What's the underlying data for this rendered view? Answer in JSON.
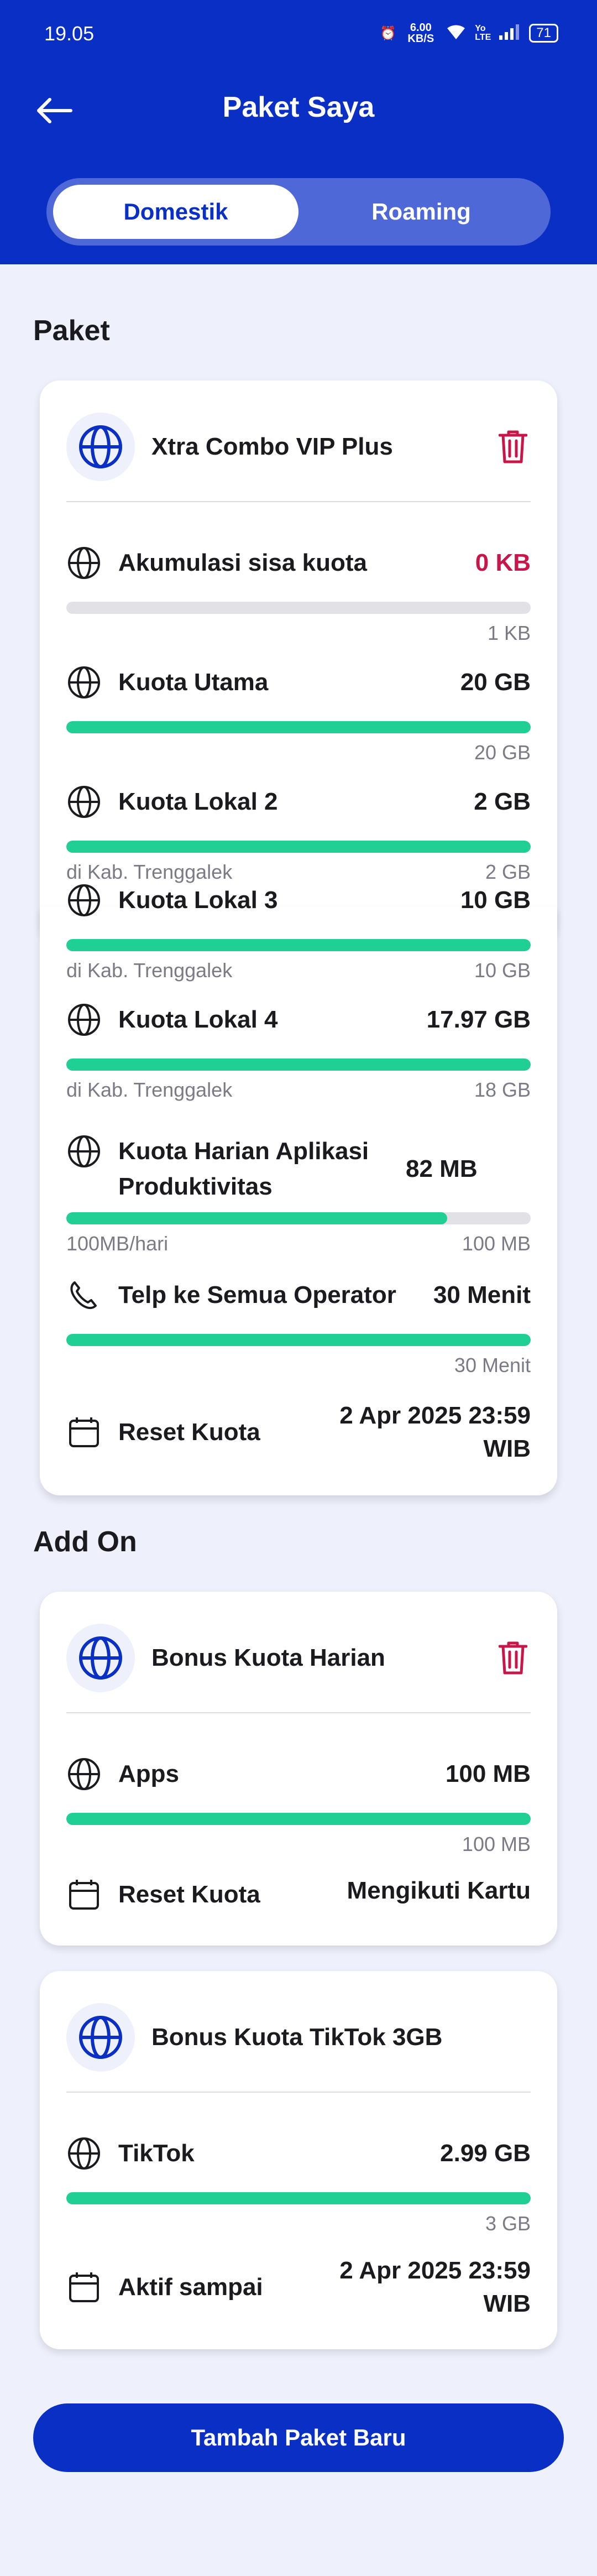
{
  "status_bar": {
    "time": "19.05",
    "speed": "6.00 KB/S",
    "network": "Yo LTE",
    "battery": "71"
  },
  "header": {
    "title": "Paket Saya",
    "tabs": [
      {
        "label": "Domestik",
        "active": true
      },
      {
        "label": "Roaming",
        "active": false
      }
    ]
  },
  "sections": {
    "paket": "Paket",
    "addon": "Add On"
  },
  "main_package": {
    "name": "Xtra Combo VIP Plus",
    "rows": [
      {
        "label": "Akumulasi sisa kuota",
        "value": "0 KB",
        "fill": 0,
        "left": "",
        "right": "1 KB"
      },
      {
        "label": "Kuota Utama",
        "value": "20 GB",
        "fill": 1,
        "left": "",
        "right": "20 GB"
      },
      {
        "label": "Kuota Lokal 2",
        "value": "2 GB",
        "fill": 1,
        "left": "di Kab. Trenggalek",
        "right": "2 GB"
      },
      {
        "label": "Kuota Lokal 3",
        "value": "10 GB",
        "fill": 1,
        "left": "di Kab. Trenggalek",
        "right": "10 GB"
      },
      {
        "label": "Kuota Lokal 4",
        "value": "17.97 GB",
        "fill": 1,
        "left": "di Kab. Trenggalek",
        "right": "18 GB"
      },
      {
        "label": "Kuota Harian Aplikasi Produktivitas",
        "value": "82 MB",
        "fill": 0.82,
        "left": "100MB/hari",
        "right": "100 MB"
      },
      {
        "label": "Telp ke Semua Operator",
        "value": "30 Menit",
        "fill": 1,
        "left": "",
        "right": "30 Menit"
      }
    ],
    "reset": {
      "label": "Reset Kuota",
      "value_line1": "2 Apr 2025 23:59",
      "value_line2": "WIB"
    }
  },
  "addon1": {
    "name": "Bonus Kuota Harian",
    "row": {
      "label": "Apps",
      "value": "100 MB",
      "fill": 1,
      "right": "100 MB"
    },
    "reset": {
      "label": "Reset Kuota",
      "value": "Mengikuti Kartu"
    }
  },
  "addon2": {
    "name": "Bonus Kuota TikTok 3GB",
    "row": {
      "label": "TikTok",
      "value": "2.99 GB",
      "fill": 1,
      "right": "3 GB"
    },
    "active": {
      "label": "Aktif sampai",
      "value_line1": "2 Apr 2025 23:59",
      "value_line2": "WIB"
    }
  },
  "cta": {
    "label": "Tambah Paket Baru"
  },
  "colors": {
    "brand": "#0a2fc4",
    "accent": "#1fcf93",
    "danger": "#c8154a"
  }
}
